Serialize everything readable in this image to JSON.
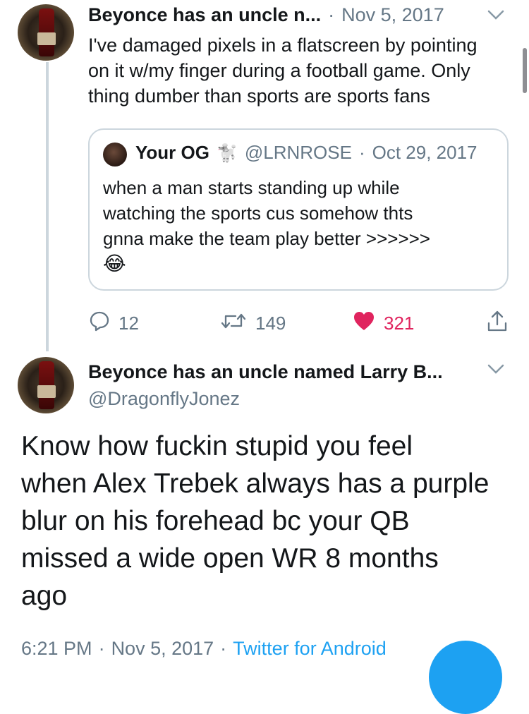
{
  "tweet1": {
    "display_name": "Beyonce has an uncle n...",
    "date": "Nov 5, 2017",
    "text_lines": [
      "I've damaged pixels in a flatscreen by pointing",
      "on it w/my finger during a football game. Only",
      "thing dumber than sports are sports fans"
    ],
    "quote": {
      "display_name": "Your OG",
      "emoji_badge": "🐩",
      "handle": "@LRNROSE",
      "date": "Oct 29, 2017",
      "text_lines": [
        "when a man starts standing up while",
        "watching the sports cus somehow thts",
        "gnna make the team play better >>>>>>"
      ],
      "emoji": "😂"
    },
    "actions": {
      "replies": "12",
      "retweets": "149",
      "likes": "321"
    }
  },
  "tweet2": {
    "display_name": "Beyonce has an uncle named Larry B...",
    "handle": "@DragonflyJonez",
    "text_lines": [
      "Know how fuckin stupid you feel",
      "when Alex Trebek always has a purple",
      "blur on his forehead bc your QB",
      "missed a wide open WR 8 months",
      "ago"
    ],
    "time": "6:21 PM",
    "date": "Nov 5, 2017",
    "source": "Twitter for Android"
  },
  "separator": "·",
  "icons": {
    "chevron": "chevron-down-icon",
    "reply": "reply-icon",
    "retweet": "retweet-icon",
    "like": "heart-icon",
    "share": "share-icon",
    "compose": "compose-fab"
  },
  "colors": {
    "accent": "#1da1f2",
    "like": "#e0245e",
    "secondary_text": "#657786",
    "border": "#ccd6dd"
  }
}
